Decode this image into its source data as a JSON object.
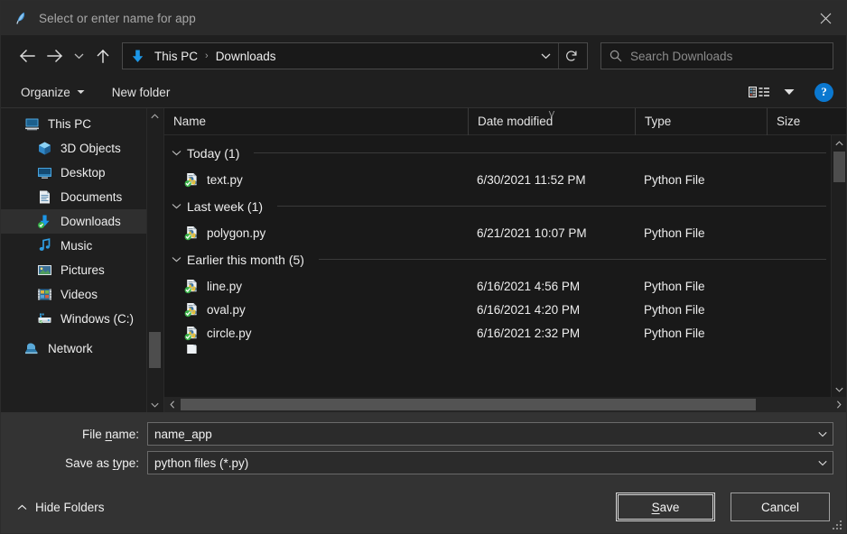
{
  "window": {
    "title": "Select or enter name for app",
    "app_icon": "feather-quill-icon",
    "close_label": "✕"
  },
  "navbar": {
    "back_icon": "arrow-left-icon",
    "forward_icon": "arrow-right-icon",
    "recent_icon": "chevron-down-icon",
    "up_icon": "arrow-up-icon",
    "breadcrumb": {
      "location_icon": "downloads-arrow-icon",
      "items": [
        "This PC",
        "Downloads"
      ],
      "separator": "›",
      "dropdown_icon": "chevron-down-icon",
      "refresh_icon": "refresh-icon"
    },
    "search": {
      "icon": "search-icon",
      "placeholder": "Search Downloads",
      "value": ""
    }
  },
  "toolbar": {
    "organize_label": "Organize",
    "organize_caret": "▼",
    "new_folder_label": "New folder",
    "view_icon": "list-view-icon",
    "view_caret": "▼",
    "help_label": "?"
  },
  "sidebar": {
    "scroll_up_icon": "chevron-up-icon",
    "scroll_down_icon": "chevron-down-icon",
    "items": [
      {
        "label": "This PC",
        "icon": "monitor-icon",
        "depth": 0,
        "selected": false
      },
      {
        "label": "3D Objects",
        "icon": "cube-icon",
        "depth": 1,
        "selected": false
      },
      {
        "label": "Desktop",
        "icon": "desktop-icon",
        "depth": 1,
        "selected": false
      },
      {
        "label": "Documents",
        "icon": "document-icon",
        "depth": 1,
        "selected": false
      },
      {
        "label": "Downloads",
        "icon": "downloads-icon",
        "depth": 1,
        "selected": true
      },
      {
        "label": "Music",
        "icon": "music-note-icon",
        "depth": 1,
        "selected": false
      },
      {
        "label": "Pictures",
        "icon": "picture-icon",
        "depth": 1,
        "selected": false
      },
      {
        "label": "Videos",
        "icon": "video-icon",
        "depth": 1,
        "selected": false
      },
      {
        "label": "Windows (C:)",
        "icon": "harddrive-icon",
        "depth": 1,
        "selected": false
      },
      {
        "label": "Network",
        "icon": "network-icon",
        "depth": 0,
        "selected": false
      }
    ]
  },
  "filelist": {
    "columns": [
      "Name",
      "Date modified",
      "Type",
      "Size"
    ],
    "sort_indicator": "˅",
    "sorted_column": "Date modified",
    "groups": [
      {
        "label": "Today (1)",
        "chevron": "chevron-down-icon",
        "files": [
          {
            "name": "text.py",
            "date": "6/30/2021 11:52 PM",
            "type": "Python File",
            "size": "",
            "icon": "python-file-icon"
          }
        ]
      },
      {
        "label": "Last week (1)",
        "chevron": "chevron-down-icon",
        "files": [
          {
            "name": "polygon.py",
            "date": "6/21/2021 10:07 PM",
            "type": "Python File",
            "size": "",
            "icon": "python-file-icon"
          }
        ]
      },
      {
        "label": "Earlier this month (5)",
        "chevron": "chevron-down-icon",
        "files": [
          {
            "name": "line.py",
            "date": "6/16/2021 4:56 PM",
            "type": "Python File",
            "size": "",
            "icon": "python-file-icon"
          },
          {
            "name": "oval.py",
            "date": "6/16/2021 4:20 PM",
            "type": "Python File",
            "size": "",
            "icon": "python-file-icon"
          },
          {
            "name": "circle.py",
            "date": "6/16/2021 2:32 PM",
            "type": "Python File",
            "size": "",
            "icon": "python-file-icon"
          }
        ]
      }
    ],
    "h_scroll_left_icon": "chevron-left-icon",
    "h_scroll_right_icon": "chevron-right-icon",
    "v_scroll_up_icon": "chevron-up-icon",
    "v_scroll_down_icon": "chevron-down-icon"
  },
  "form": {
    "filename": {
      "label_pre": "File ",
      "label_accel": "n",
      "label_post": "ame:",
      "value": "name_app",
      "dropdown_icon": "chevron-down-icon"
    },
    "savetype": {
      "label_pre": "Save as ",
      "label_accel": "t",
      "label_post": "ype:",
      "value": "python files (*.py)",
      "dropdown_icon": "chevron-down-icon"
    }
  },
  "actions": {
    "hide_folders_label": "Hide Folders",
    "hide_folders_icon": "chevron-up-icon",
    "save": {
      "pre": "",
      "accel": "S",
      "post": "ave"
    },
    "cancel_label": "Cancel",
    "resize_grip": "resize-grip-icon"
  },
  "colors": {
    "window_bg": "#1f1f1f",
    "titlebar_bg": "#2b2b2b",
    "list_bg": "#191919",
    "form_bg": "#333333",
    "accent_blue": "#0b78d0",
    "selection": "#2f2f2f",
    "text": "#ededed",
    "muted_text": "#8b8b8b"
  }
}
